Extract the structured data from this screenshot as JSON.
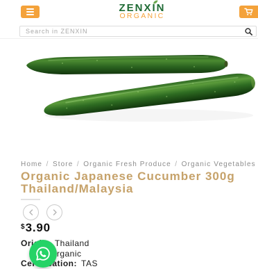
{
  "theme": {
    "accent": "#f4a23a",
    "logo-green": "#1f6b35",
    "title-tan": "#c6a26a",
    "whatsapp-green": "#25d366"
  },
  "header": {
    "logo_name": "ZENXIN",
    "logo_tagline": "ORGANIC",
    "menu_icon": "hamburger-menu-icon",
    "cart_icon": "shopping-cart-icon"
  },
  "search": {
    "placeholder": "Search in ZENXIN",
    "icon": "search-icon"
  },
  "product": {
    "breadcrumb": {
      "items": [
        "Home",
        "Store",
        "Organic Fresh Produce",
        "Organic Vegetables"
      ],
      "separator": "/"
    },
    "title": "Organic Japanese Cucumber 300g Thailand/Malaysia",
    "gallery_nav": {
      "prev_icon": "chevron-left-icon",
      "next_icon": "chevron-right-icon"
    },
    "price": {
      "currency": "$",
      "amount": "3.90"
    },
    "specs": [
      {
        "label": "Origin:",
        "value": "Thailand"
      },
      {
        "value": "Organic"
      },
      {
        "label": "Certification:",
        "value": "TAS"
      }
    ]
  },
  "whatsapp": {
    "icon": "whatsapp-icon"
  }
}
